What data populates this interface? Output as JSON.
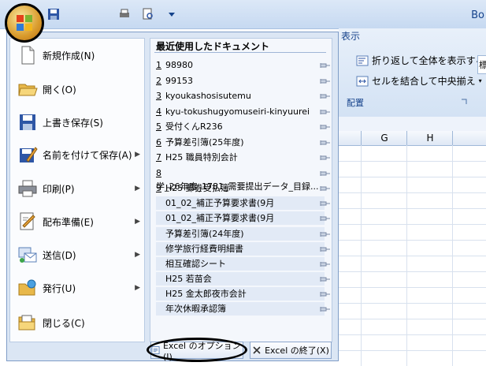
{
  "window": {
    "title": "Bo"
  },
  "ribbon": {
    "tab": "表示",
    "wrap_text": "折り返して全体を表示する",
    "merge_center": "セルを結合して中央揃え",
    "group_label": "配置",
    "right_cut": "標"
  },
  "sheet": {
    "columns": [
      "G",
      "H"
    ]
  },
  "menu": {
    "commands": [
      {
        "label": "新規作成(N)",
        "icon": "new-document-icon",
        "arrow": false
      },
      {
        "label": "開く(O)",
        "icon": "open-folder-icon",
        "arrow": false
      },
      {
        "label": "上書き保存(S)",
        "icon": "save-disk-icon",
        "arrow": false
      },
      {
        "label": "名前を付けて保存(A)",
        "icon": "save-as-icon",
        "arrow": true
      },
      {
        "label": "印刷(P)",
        "icon": "printer-icon",
        "arrow": true
      },
      {
        "label": "配布準備(E)",
        "icon": "prepare-icon",
        "arrow": true
      },
      {
        "label": "送信(D)",
        "icon": "send-icon",
        "arrow": true
      },
      {
        "label": "発行(U)",
        "icon": "publish-icon",
        "arrow": true
      },
      {
        "label": "閉じる(C)",
        "icon": "close-folder-icon",
        "arrow": false
      }
    ],
    "recent_title": "最近使用したドキュメント",
    "recent_docs": [
      {
        "num": "1",
        "name": "98980"
      },
      {
        "num": "2",
        "name": "99153"
      },
      {
        "num": "3",
        "name": "kyoukashosisutemu"
      },
      {
        "num": "4",
        "name": "kyu-tokushugyomuseiri-kinyuurei"
      },
      {
        "num": "5",
        "name": "受付くんR236"
      },
      {
        "num": "6",
        "name": "予算差引簿(25年度)"
      },
      {
        "num": "7",
        "name": "H25 職員特別会計"
      },
      {
        "num": "8",
        "name": "学_26年度_1781_需要提出データ_目録..."
      },
      {
        "num": "9",
        "name": "H25 郵券受払簿"
      },
      {
        "num": "",
        "name": "01_02_補正予算要求書(9月"
      },
      {
        "num": "",
        "name": "01_02_補正予算要求書(9月"
      },
      {
        "num": "",
        "name": "予算差引簿(24年度)"
      },
      {
        "num": "",
        "name": "修学旅行経費明細書"
      },
      {
        "num": "",
        "name": "相互確認シート"
      },
      {
        "num": "",
        "name": "H25 若苗会"
      },
      {
        "num": "",
        "name": "H25 金太郎夜市会計"
      },
      {
        "num": "",
        "name": "年次休暇承認簿"
      }
    ],
    "options_button": "Excel のオプション(I)",
    "exit_button": "Excel の終了(X)"
  }
}
